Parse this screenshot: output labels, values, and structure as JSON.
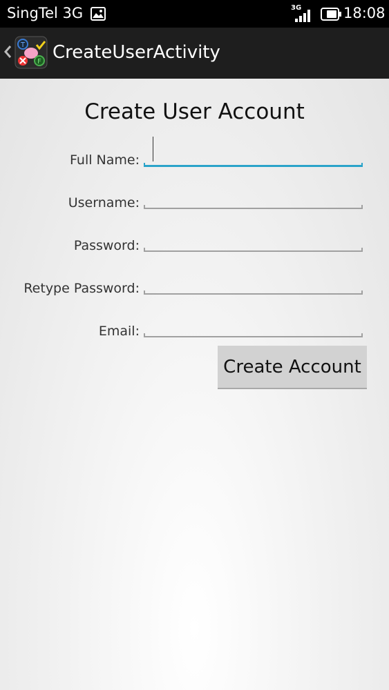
{
  "status_bar": {
    "carrier": "SingTel 3G",
    "network_type": "3G",
    "time": "18:08"
  },
  "action_bar": {
    "title": "CreateUserActivity"
  },
  "form": {
    "title": "Create User Account",
    "fields": [
      {
        "label": "Full Name:",
        "value": "",
        "focused": true
      },
      {
        "label": "Username:",
        "value": "",
        "focused": false
      },
      {
        "label": "Password:",
        "value": "",
        "focused": false
      },
      {
        "label": "Retype Password:",
        "value": "",
        "focused": false
      },
      {
        "label": "Email:",
        "value": "",
        "focused": false
      }
    ],
    "submit_label": "Create Account"
  },
  "colors": {
    "accent": "#2aa3c9",
    "action_bar": "#1e1e1e",
    "button": "#d2d2d2"
  }
}
